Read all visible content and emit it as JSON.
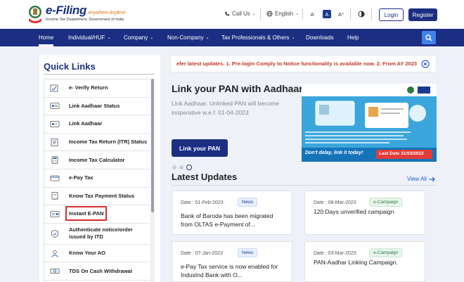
{
  "header": {
    "logo_title": "e-Filing",
    "logo_tagline": "Anywhere Anytime",
    "logo_subtitle": "Income Tax Department, Government of India",
    "call_us": "Call Us",
    "language": "English",
    "font_small": "A",
    "font_normal": "A",
    "font_large": "A",
    "font_plus": "+",
    "font_minus": "-",
    "login": "Login",
    "register": "Register"
  },
  "nav": {
    "items": [
      {
        "label": "Home"
      },
      {
        "label": "Individual/HUF"
      },
      {
        "label": "Company"
      },
      {
        "label": "Non-Company"
      },
      {
        "label": "Tax Professionals & Others"
      },
      {
        "label": "Downloads"
      },
      {
        "label": "Help"
      }
    ]
  },
  "quick_links": {
    "title": "Quick Links",
    "items": [
      {
        "label": "e- Verify Return"
      },
      {
        "label": "Link Aadhaar Status"
      },
      {
        "label": "Link Aadhaar"
      },
      {
        "label": "Income Tax Return (ITR) Status"
      },
      {
        "label": "Income Tax Calculator"
      },
      {
        "label": "e-Pay Tax"
      },
      {
        "label": "Know Tax Payment Status"
      },
      {
        "label": "Instant E-PAN"
      },
      {
        "label": "Authenticate notice/order issued by ITD"
      },
      {
        "label": "Know Your AO"
      },
      {
        "label": "TDS On Cash Withdrawal"
      }
    ]
  },
  "marquee": {
    "text": "efer latest updates.    1. Pre-login Comply to Notice functionality is available now. 2. From AY 2023"
  },
  "hero": {
    "title": "Link your PAN with Aadhaar",
    "description": "Link Aadhaar. Unlinked PAN will become inoperative w.e.f. 01-04-2023",
    "button": "Link your PAN",
    "image_tagline": "Don't delay, link it today!",
    "image_date": "Last Date 31/03/2023"
  },
  "latest_updates": {
    "title": "Latest Updates",
    "view_all": "View All",
    "cards": [
      {
        "date": "Date : 01-Feb-2023",
        "badge": "News",
        "text": "Bank of Baroda has been migrated from OLTAS e-Payment of..."
      },
      {
        "date": "Date : 08-Mar-2023",
        "badge": "e-Campaign",
        "text": "120 Days unverified campaign"
      },
      {
        "date": "Date : 07-Jan-2023",
        "badge": "News",
        "text": "e-Pay Tax service is now enabled for IndusInd Bank with O..."
      },
      {
        "date": "Date : 03-Mar-2023",
        "badge": "e-Campaign",
        "text": "PAN-Aadhar Linking Campaign."
      }
    ]
  },
  "colors": {
    "brand_navy": "#1b2e82",
    "accent_blue": "#3f82e8",
    "alert_red": "#c0392b",
    "highlight_box": "#d32f2f"
  }
}
